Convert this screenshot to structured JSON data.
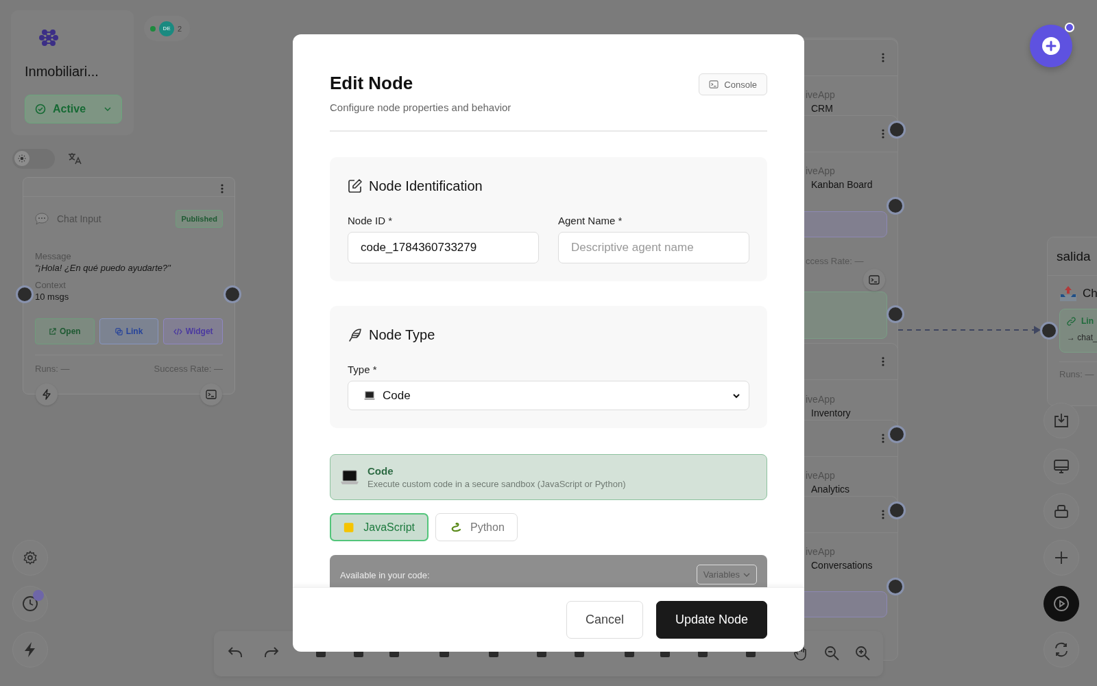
{
  "workspace": {
    "title": "Inmobiliari...",
    "status": "Active"
  },
  "presence": {
    "online": true,
    "avatar": "DE",
    "count": "2"
  },
  "theme_toggle": {
    "on": false
  },
  "chat_node": {
    "title": "Chat Input",
    "badge": "Published",
    "fields": [
      {
        "label": "Message",
        "value": "\"¡Hola! ¿En qué puedo ayudarte?\"",
        "kind": "quote"
      },
      {
        "label": "Context",
        "value": "10 msgs",
        "kind": "plain"
      }
    ],
    "actions": [
      {
        "label": "Open",
        "kind": "open"
      },
      {
        "label": "Link",
        "kind": "link"
      },
      {
        "label": "Widget",
        "kind": "widget"
      }
    ],
    "stats": [
      "Runs: —",
      "Success Rate: —"
    ]
  },
  "app_nodes": [
    {
      "source": "iveApp",
      "name": "CRM"
    },
    {
      "source": "iveApp",
      "name": "Kanban Board"
    },
    {
      "source": "iveApp",
      "name": "Inventory"
    },
    {
      "source": "iveApp",
      "name": "Analytics"
    },
    {
      "source": "iveApp",
      "name": "Conversations"
    }
  ],
  "partial_stat": "ccess Rate: —",
  "salida_node": {
    "title": "salida",
    "item": "Ch",
    "link": "Lin",
    "target": "→ chat_",
    "stats": "Runs: —"
  },
  "modal": {
    "title": "Edit Node",
    "subtitle": "Configure node properties and behavior",
    "console": "Console",
    "identification": {
      "title": "Node Identification",
      "fields": [
        {
          "label": "Node ID *",
          "value": "code_1784360733279"
        },
        {
          "label": "Agent Name *",
          "placeholder": "Descriptive agent name"
        }
      ]
    },
    "node_type": {
      "title": "Node Type",
      "label": "Type *",
      "value": "Code"
    },
    "info": {
      "title": "Code",
      "description": "Execute custom code in a secure sandbox (JavaScript or Python)"
    },
    "languages": [
      {
        "label": "JavaScript",
        "kind": "javascript",
        "selected": true
      },
      {
        "label": "Python",
        "kind": "python",
        "selected": false
      }
    ],
    "code_panel": {
      "hint": "Available in your code:",
      "menu": "Variables"
    },
    "buttons": [
      {
        "label": "Cancel",
        "kind": "secondary"
      },
      {
        "label": "Update Node",
        "kind": "primary"
      }
    ]
  }
}
